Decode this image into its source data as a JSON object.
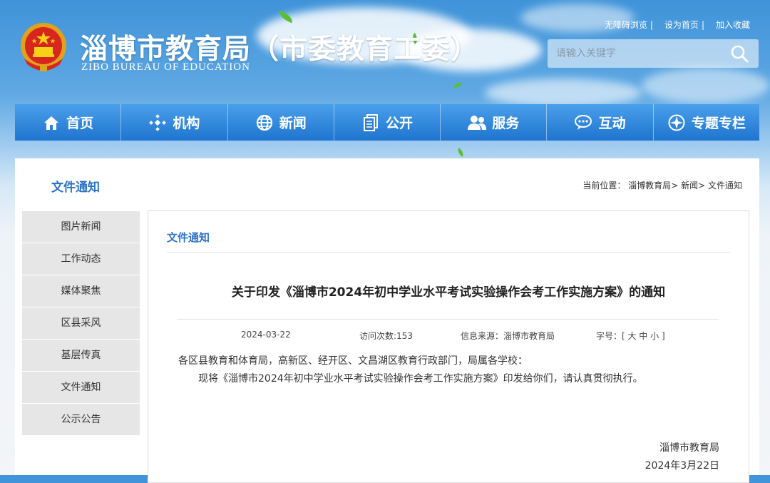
{
  "header": {
    "title": "淄博市教育局（市委教育工委）",
    "subtitle": "ZIBO BUREAU OF EDUCATION",
    "links": [
      {
        "label": "无障碍浏览"
      },
      {
        "label": "设为首页"
      },
      {
        "label": "加入收藏"
      }
    ],
    "link_separator": "|",
    "search": {
      "placeholder": "请输入关键字",
      "icon": "search-icon"
    }
  },
  "nav": {
    "items": [
      {
        "label": "首页",
        "icon": "home-icon"
      },
      {
        "label": "机构",
        "icon": "organization-icon"
      },
      {
        "label": "新闻",
        "icon": "globe-icon"
      },
      {
        "label": "公开",
        "icon": "document-icon"
      },
      {
        "label": "服务",
        "icon": "users-icon"
      },
      {
        "label": "互动",
        "icon": "chat-icon"
      },
      {
        "label": "专题专栏",
        "icon": "compass-icon"
      }
    ]
  },
  "section": {
    "title": "文件通知"
  },
  "breadcrumb": {
    "prefix": "当前位置：",
    "items": [
      "淄博教育局",
      "新闻",
      "文件通知"
    ],
    "separator": ">"
  },
  "sidebar": {
    "items": [
      {
        "label": "图片新闻"
      },
      {
        "label": "工作动态"
      },
      {
        "label": "媒体聚焦"
      },
      {
        "label": "区县采风"
      },
      {
        "label": "基层传真"
      },
      {
        "label": "文件通知"
      },
      {
        "label": "公示公告"
      }
    ]
  },
  "article": {
    "category": "文件通知",
    "title": "关于印发《淄博市2024年初中学业水平考试实验操作会考工作实施方案》的通知",
    "meta": {
      "date": "2024-03-22",
      "visits": "访问次数:153",
      "source": "信息来源：淄博市教育局",
      "font_size": "字号：[ 大 中 小 ]"
    },
    "body": [
      "各区县教育和体育局，高新区、经开区、文昌湖区教育行政部门，局属各学校：",
      "现将《淄博市2024年初中学业水平考试实验操作会考工作实施方案》印发给你们，请认真贯彻执行。"
    ],
    "signature": {
      "org": "淄博市教育局",
      "date": "2024年3月22日"
    }
  },
  "colors": {
    "nav_top": "#4aa0ea",
    "nav_bottom": "#1f74cf",
    "accent": "#2c72c7",
    "sidebar_bg": "#e6e6e6"
  }
}
